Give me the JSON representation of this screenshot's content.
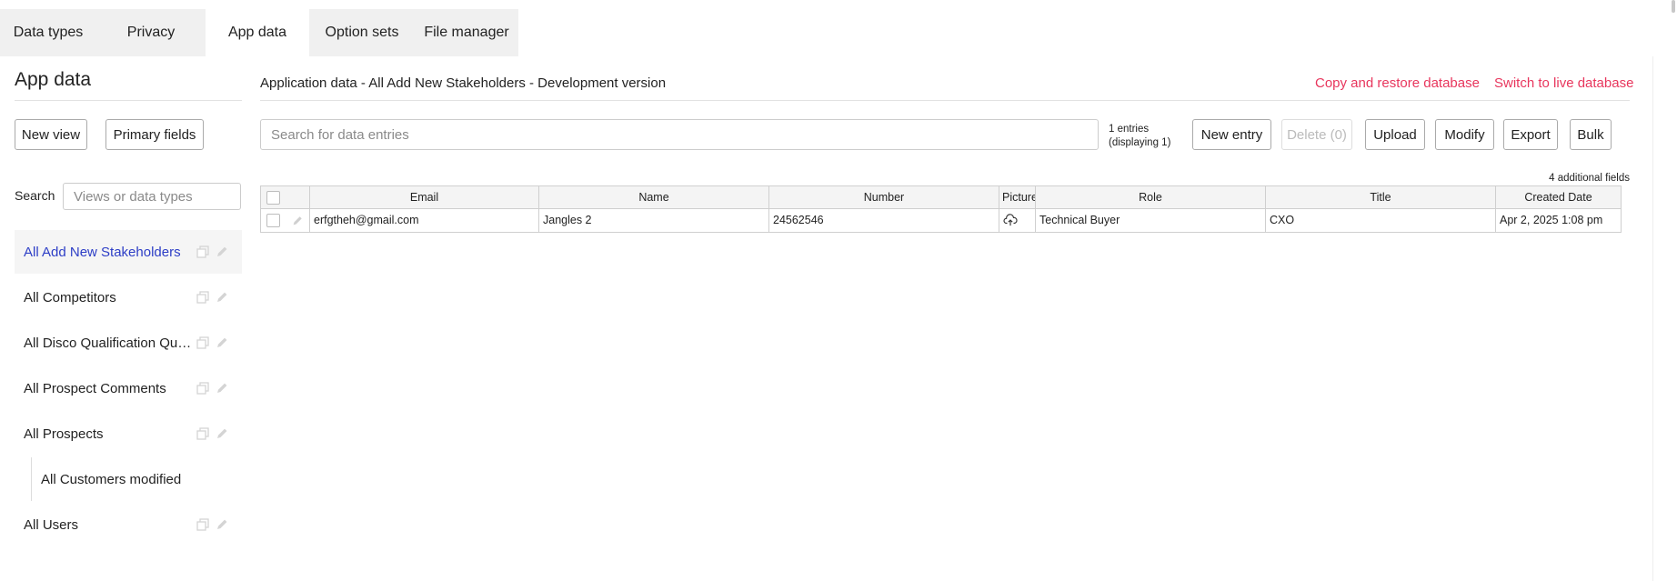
{
  "tabs": [
    {
      "label": "Data types"
    },
    {
      "label": "Privacy"
    },
    {
      "label": "App data"
    },
    {
      "label": "Option sets"
    },
    {
      "label": "File manager"
    }
  ],
  "sidebar": {
    "title": "App data",
    "new_view_label": "New view",
    "primary_fields_label": "Primary fields",
    "search_label": "Search",
    "search_placeholder": "Views or data types",
    "items": [
      {
        "label": "All Add New Stakeholders"
      },
      {
        "label": "All Competitors"
      },
      {
        "label": "All Disco Qualification Questions"
      },
      {
        "label": "All Prospect Comments"
      },
      {
        "label": "All Prospects"
      },
      {
        "label": "All Customers modified"
      },
      {
        "label": "All Users"
      }
    ]
  },
  "header": {
    "title": "Application data - All Add New Stakeholders - Development version",
    "copy_restore_label": "Copy and restore database",
    "switch_live_label": "Switch to live database"
  },
  "toolbar": {
    "search_placeholder": "Search for data entries",
    "entries_line1": "1 entries",
    "entries_line2": "(displaying 1)",
    "new_entry_label": "New entry",
    "delete_label": "Delete (0)",
    "upload_label": "Upload",
    "modify_label": "Modify",
    "export_label": "Export",
    "bulk_label": "Bulk",
    "additional_fields": "4 additional fields"
  },
  "table": {
    "columns": [
      "Email",
      "Name",
      "Number",
      "Picture",
      "Role",
      "Title",
      "Created Date"
    ],
    "rows": [
      {
        "email": "erfgtheh@gmail.com",
        "name": "Jangles 2",
        "number": "24562546",
        "role": "Technical Buyer",
        "title": "CXO",
        "created": "Apr 2, 2025 1:08 pm"
      }
    ]
  },
  "colors": {
    "accent_link": "#e8365d",
    "active_item_text": "#2d3ec6",
    "tab_bar_bg": "#f0f0f0"
  },
  "icons": [
    "copy-icon",
    "pencil-icon",
    "upload-cloud-icon"
  ]
}
